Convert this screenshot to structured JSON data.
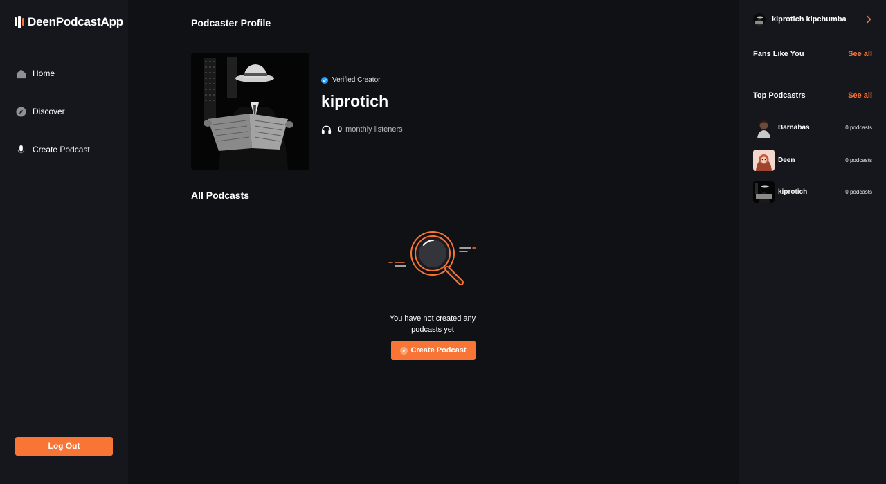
{
  "app": {
    "name": "DeenPodcastApp"
  },
  "sidebar": {
    "items": [
      {
        "label": "Home",
        "icon": "home-icon"
      },
      {
        "label": "Discover",
        "icon": "compass-icon"
      },
      {
        "label": "Create Podcast",
        "icon": "microphone-icon"
      }
    ],
    "logout_label": "Log Out"
  },
  "main": {
    "page_title": "Podcaster Profile",
    "profile": {
      "verified_label": "Verified Creator",
      "username": "kiprotich",
      "listener_count": "0",
      "listener_label": "monthly listeners"
    },
    "podcasts_section_title": "All Podcasts",
    "empty_state": {
      "message": "You have not created any podcasts yet",
      "button_label": "Create Podcast"
    }
  },
  "right_sidebar": {
    "user": {
      "name": "kiprotich kipchumba"
    },
    "fans": {
      "title": "Fans Like You",
      "see_all": "See all"
    },
    "top_podcasters": {
      "title": "Top Podcastrs",
      "see_all": "See all",
      "items": [
        {
          "name": "Barnabas",
          "count": "0 podcasts"
        },
        {
          "name": "Deen",
          "count": "0 podcasts"
        },
        {
          "name": "kiprotich",
          "count": "0 podcasts"
        }
      ]
    }
  },
  "colors": {
    "accent": "#f97535",
    "background": "#101114",
    "sidebar": "#15171c",
    "verified": "#2b9bf4"
  }
}
